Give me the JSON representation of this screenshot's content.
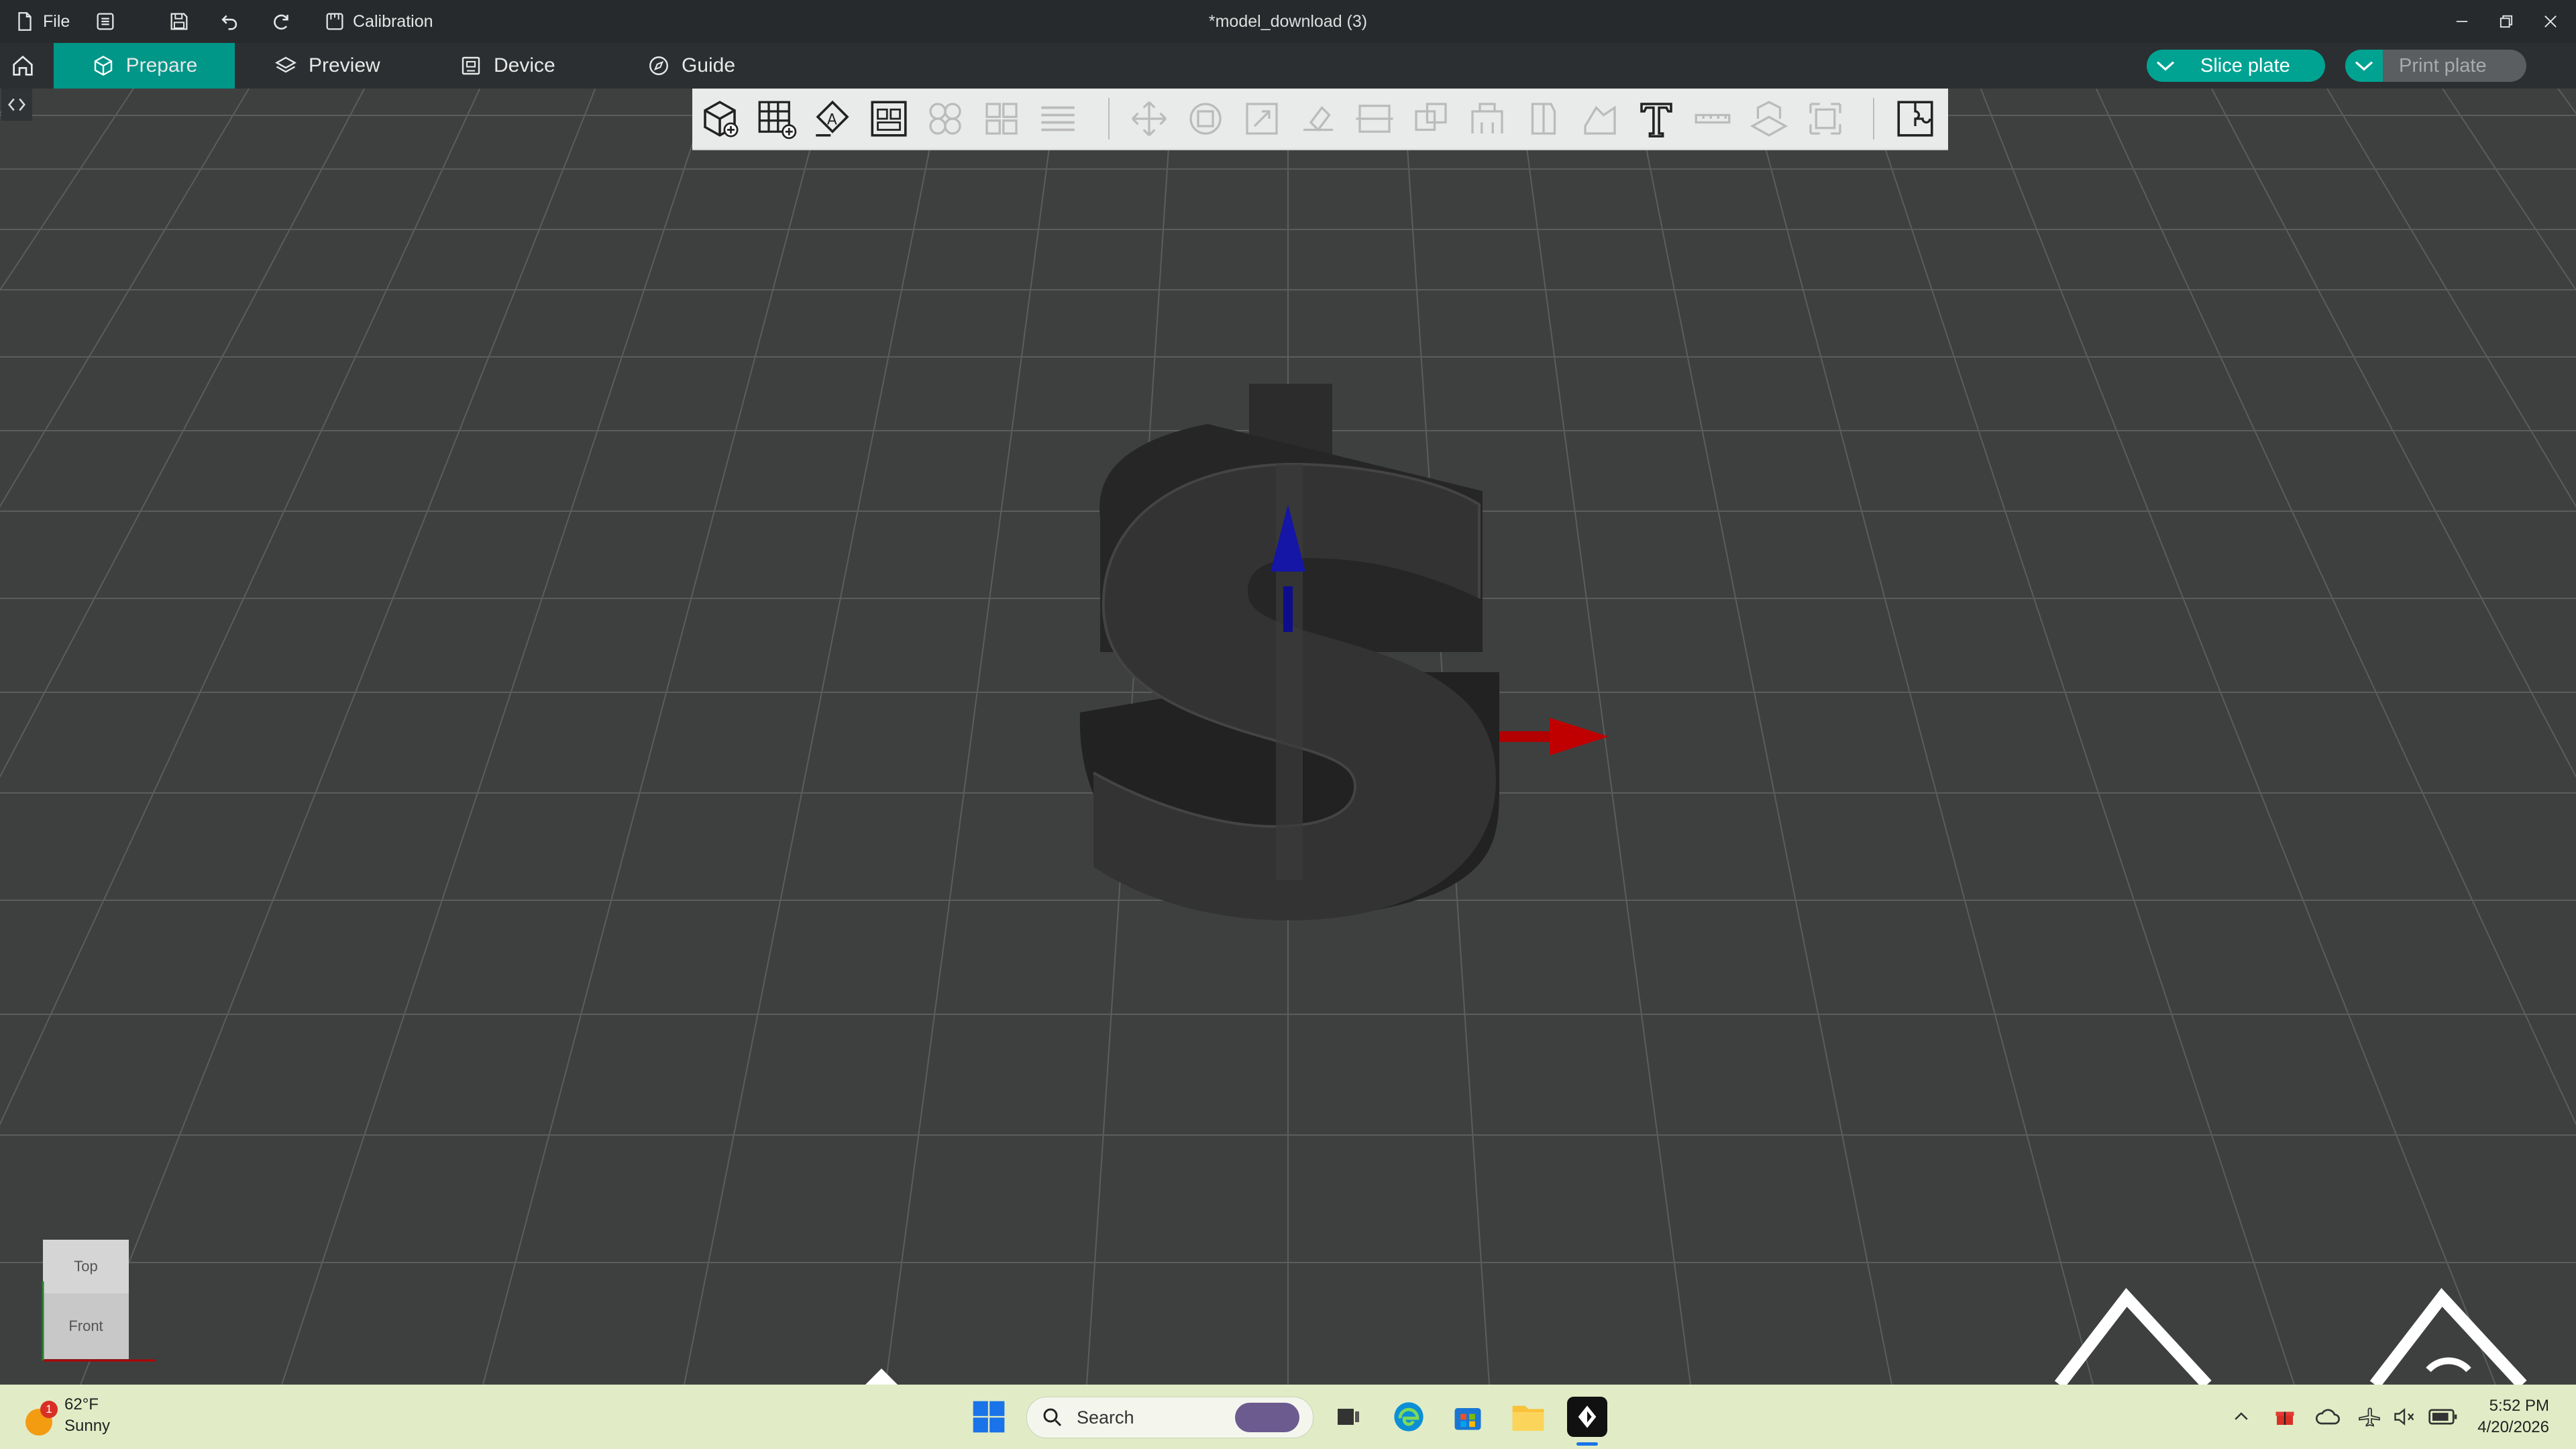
{
  "titlebar": {
    "file_label": "File",
    "calibration_label": "Calibration",
    "document_title": "*model_download (3)"
  },
  "nav": {
    "tabs": [
      {
        "label": "Prepare",
        "icon": "cube-icon",
        "active": true
      },
      {
        "label": "Preview",
        "icon": "layers-icon",
        "active": false
      },
      {
        "label": "Device",
        "icon": "device-icon",
        "active": false
      },
      {
        "label": "Guide",
        "icon": "compass-icon",
        "active": false
      }
    ],
    "slice_label": "Slice plate",
    "print_label": "Print plate"
  },
  "toolbar": {
    "tools": [
      "add-object-icon",
      "add-plate-icon",
      "auto-orient-icon",
      "arrange-icon",
      "split-objects-icon",
      "split-parts-icon",
      "layers-edit-icon",
      "move-icon",
      "rotate-icon",
      "scale-icon",
      "lay-on-face-icon",
      "cut-icon",
      "boolean-icon",
      "support-paint-icon",
      "seam-paint-icon",
      "color-paint-icon",
      "text-tool-icon",
      "measure-icon",
      "assembly-icon",
      "fit-view-icon",
      "puzzle-icon"
    ]
  },
  "viewcube": {
    "top_label": "Top",
    "front_label": "Front"
  },
  "colors": {
    "accent": "#009688",
    "viewport": "#3e4040",
    "model": "#2b2b2b",
    "axis_z": "#0d0d8c",
    "axis_x": "#b30000"
  },
  "taskbar": {
    "weather_temp": "62°F",
    "weather_desc": "Sunny",
    "weather_badge": "1",
    "search_placeholder": "Search",
    "time": "5:52 PM",
    "date": "4/20/2026"
  }
}
